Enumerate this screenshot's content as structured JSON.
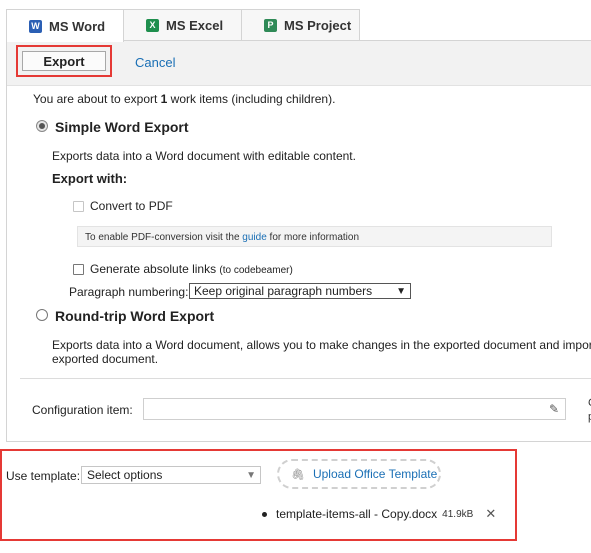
{
  "tabs": [
    {
      "label": "MS Word",
      "icon": "word-icon",
      "letter": "W",
      "active": true
    },
    {
      "label": "MS Excel",
      "icon": "excel-icon",
      "letter": "X",
      "active": false
    },
    {
      "label": "MS Project",
      "icon": "project-icon",
      "letter": "P",
      "active": false
    }
  ],
  "toolbar": {
    "export_label": "Export",
    "cancel_label": "Cancel"
  },
  "intro": {
    "prefix": "You are about to export ",
    "count": "1",
    "suffix": " work items (including children)."
  },
  "simple": {
    "title": "Simple Word Export",
    "description": "Exports data into a Word document with editable content.",
    "export_with": "Export with:",
    "convert_pdf": "Convert to PDF",
    "pdf_info_prefix": "To enable PDF-conversion visit the ",
    "pdf_info_link": "guide",
    "pdf_info_suffix": " for more information",
    "abs_links": "Generate absolute links",
    "abs_links_note": "(to codebeamer)",
    "para_label": "Paragraph numbering:",
    "para_value": "Keep original paragraph numbers"
  },
  "roundtrip": {
    "title": "Round-trip Word Export",
    "desc_line1": "Exports data into a Word document, allows you to make changes in the exported document and import th",
    "desc_line2": "exported document."
  },
  "config": {
    "label": "Configuration item:",
    "side_top": "C",
    "side_bottom": "p"
  },
  "template": {
    "label": "Use template:",
    "select_value": "Select options",
    "upload_label": "Upload Office Template",
    "file_name": "template-items-all - Copy.docx",
    "file_size": "41.9kB"
  },
  "colors": {
    "highlight_border": "#e53935",
    "link": "#1a6fb5"
  }
}
